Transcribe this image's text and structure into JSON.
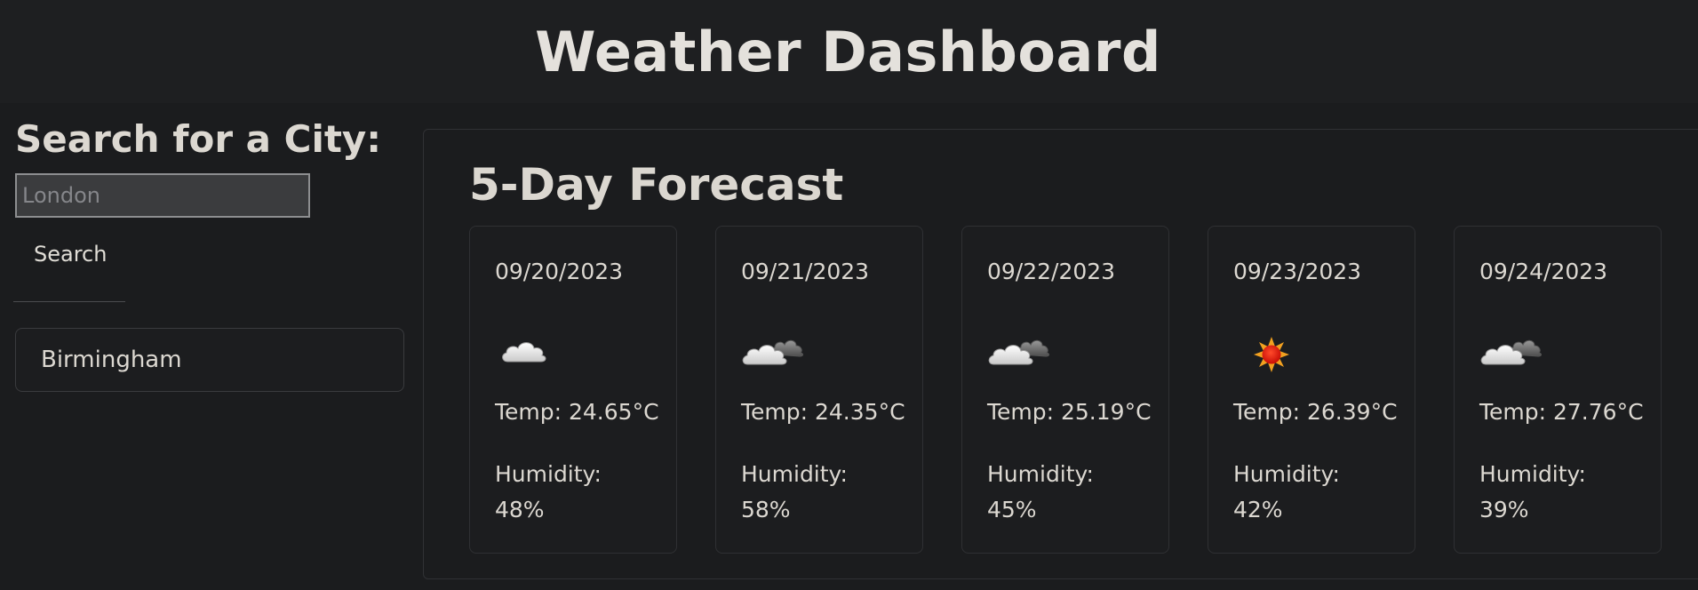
{
  "header": {
    "title": "Weather Dashboard"
  },
  "search": {
    "title": "Search for a City:",
    "input_value": "",
    "placeholder": "London",
    "button_label": "Search"
  },
  "history": {
    "items": [
      "Birmingham"
    ]
  },
  "forecast": {
    "title": "5-Day Forecast",
    "humidity_label": "Humidity:",
    "days": [
      {
        "date": "09/20/2023",
        "icon": "cloud-icon",
        "temp": "Temp: 24.65°C",
        "humidity": "48%"
      },
      {
        "date": "09/21/2023",
        "icon": "broken-clouds-icon",
        "temp": "Temp: 24.35°C",
        "humidity": "58%"
      },
      {
        "date": "09/22/2023",
        "icon": "broken-clouds-icon",
        "temp": "Temp: 25.19°C",
        "humidity": "45%"
      },
      {
        "date": "09/23/2023",
        "icon": "sun-icon",
        "temp": "Temp: 26.39°C",
        "humidity": "42%"
      },
      {
        "date": "09/24/2023",
        "icon": "broken-clouds-icon",
        "temp": "Temp: 27.76°C",
        "humidity": "39%"
      }
    ]
  },
  "colors": {
    "background": "#1b1c1e",
    "header_background": "#1e1f21",
    "text": "#dedad3",
    "sun_red": "#e8170c",
    "sun_orange": "#f2a120"
  }
}
